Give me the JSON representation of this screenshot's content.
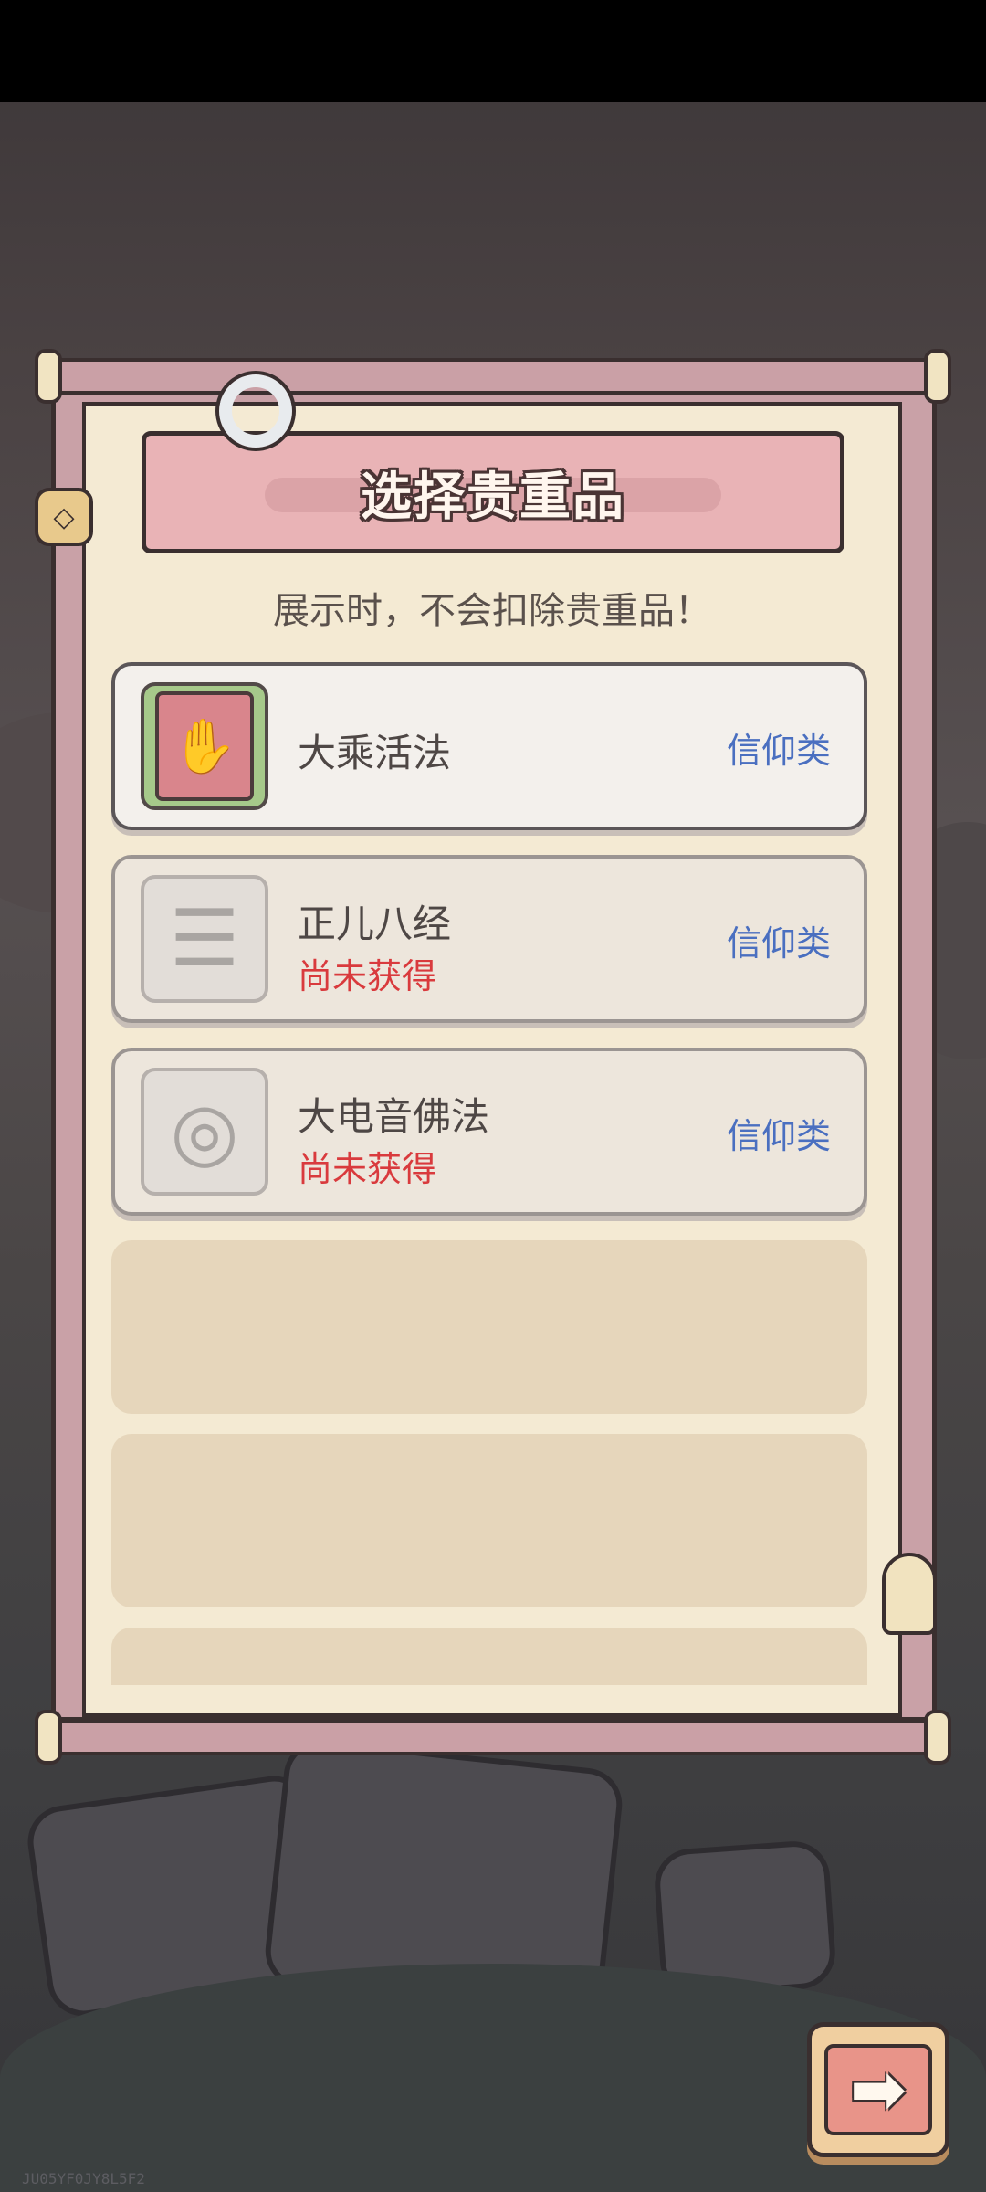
{
  "dialog": {
    "title": "选择贵重品",
    "subtitle": "展示时，不会扣除贵重品！"
  },
  "items": [
    {
      "name": "大乘活法",
      "status": "",
      "category": "信仰类",
      "icon": "hand-book-icon",
      "obtained": true
    },
    {
      "name": "正儿八经",
      "status": "尚未获得",
      "category": "信仰类",
      "icon": "scroll-stack-icon",
      "obtained": false
    },
    {
      "name": "大电音佛法",
      "status": "尚未获得",
      "category": "信仰类",
      "icon": "coin-disc-icon",
      "obtained": false
    }
  ],
  "next_button": {
    "icon": "arrow-right-icon"
  },
  "watermark": "JU05YF0JY8L5F2",
  "colors": {
    "panel_frame": "#c9a1a7",
    "panel_inner": "#f4ead3",
    "title_plaque": "#e9b3b6",
    "status_red": "#d93a3d",
    "category_blue": "#4a6fc0"
  }
}
